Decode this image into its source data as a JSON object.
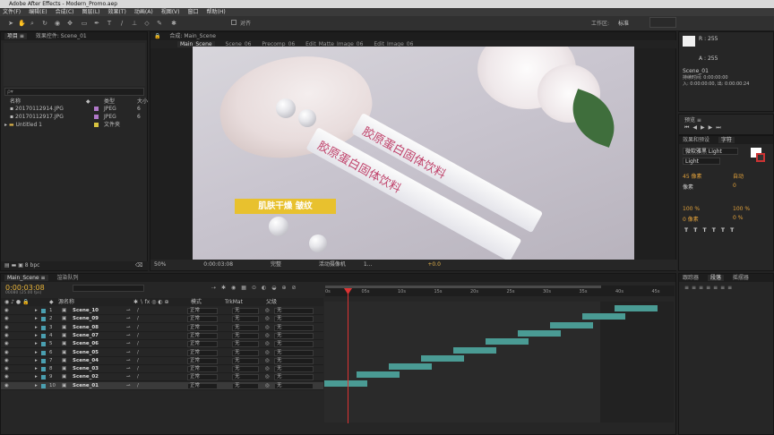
{
  "app": {
    "title": "Adobe After Effects - Modern_Promo.aep",
    "menu": [
      "文件(F)",
      "编辑(E)",
      "合成(C)",
      "图层(L)",
      "效果(T)",
      "动画(A)",
      "视图(V)",
      "窗口",
      "帮助(H)"
    ],
    "snap_label": "对齐",
    "workspace_label": "工作区:",
    "workspace_value": "标准"
  },
  "project": {
    "tabs": [
      "项目 ≡",
      "效果控件: Scene_01"
    ],
    "search_placeholder": "ρ▾",
    "col_name": "名称",
    "col_type": "类型",
    "col_size": "大小",
    "items": [
      {
        "name": "20170112914.JPG",
        "type": "JPEG",
        "size": "6"
      },
      {
        "name": "20170112917.JPG",
        "type": "JPEG",
        "size": "6"
      },
      {
        "name": "Untitled 1",
        "type": "文件夹",
        "size": ""
      }
    ],
    "bpc": "8 bpc"
  },
  "viewer": {
    "header": "合成: Main_Scene",
    "tabs": [
      "Main_Scene",
      "Scene_06",
      "Precomp_06",
      "Edit_Matte_Image_06",
      "Edit_Image_06"
    ],
    "active_tab": "Main_Scene",
    "caption": "肌肤干燥 皱纹",
    "packet_text": "胶原蛋白固体饮料",
    "zoom": "50%",
    "timecode": "0:00:03:08",
    "resolution": "完整",
    "camera": "活动摄像机",
    "views": "1...",
    "exposure": "+0.0"
  },
  "info": {
    "r": "R : 255",
    "a": "A : 255",
    "layer": "Scene_01",
    "dur": "持续时间: 0:00:00:00",
    "io": "入: 0:00:00:00, 出: 0:00:00:24"
  },
  "preview": {
    "title": "预览 ≡"
  },
  "effects": {
    "title": "效果和预设",
    "char_title": "字符"
  },
  "character": {
    "font": "微软雅黑 Light",
    "style": "Light",
    "size": "45 像素",
    "leading": "自动",
    "kerning": "像素",
    "tracking": "0",
    "vscale": "100 %",
    "hscale": "100 %",
    "baseline": "0 像素",
    "tsume": "0 %"
  },
  "align": {
    "tabs": [
      "跟踪器",
      "段落",
      "摇摆器"
    ]
  },
  "timeline": {
    "tabs": [
      "Main_Scene ≡",
      "渲染队列"
    ],
    "timecode": "0:00:03:08",
    "fps": "00080 (25.00 fps)",
    "col_name": "源名称",
    "col_mode": "模式",
    "col_trkmat": "TrkMat",
    "col_parent": "父级",
    "ruler": [
      "0s",
      "05s",
      "10s",
      "15s",
      "20s",
      "25s",
      "30s",
      "35s",
      "40s",
      "45s"
    ],
    "layers": [
      {
        "num": "1",
        "name": "Scene_10",
        "mode": "正常",
        "parent": "无"
      },
      {
        "num": "2",
        "name": "Scene_09",
        "mode": "正常",
        "parent": "无"
      },
      {
        "num": "3",
        "name": "Scene_08",
        "mode": "正常",
        "parent": "无"
      },
      {
        "num": "4",
        "name": "Scene_07",
        "mode": "正常",
        "parent": "无"
      },
      {
        "num": "5",
        "name": "Scene_06",
        "mode": "正常",
        "parent": "无"
      },
      {
        "num": "6",
        "name": "Scene_05",
        "mode": "正常",
        "parent": "无"
      },
      {
        "num": "7",
        "name": "Scene_04",
        "mode": "正常",
        "parent": "无"
      },
      {
        "num": "8",
        "name": "Scene_03",
        "mode": "正常",
        "parent": "无"
      },
      {
        "num": "9",
        "name": "Scene_02",
        "mode": "正常",
        "parent": "无"
      },
      {
        "num": "10",
        "name": "Scene_01",
        "mode": "正常",
        "parent": "无"
      }
    ],
    "trkmat_value": "无"
  },
  "colors": {
    "accent": "#4a9b94",
    "timecode": "#e8b43a",
    "playhead": "#d33"
  }
}
